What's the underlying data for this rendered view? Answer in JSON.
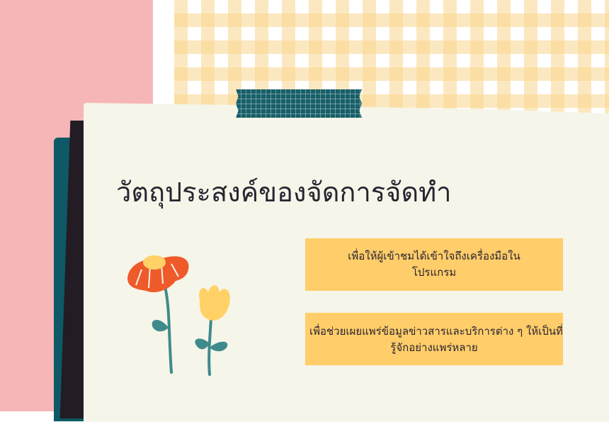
{
  "slide": {
    "title": "วัตถุประสงค์ของจัดการจัดทำ",
    "objectives": [
      {
        "line1": "เพื่อให้ผู้เข้าชมได้เข้าใจถึงเครื่องมือใน",
        "line2": "โปรแกรม"
      },
      {
        "line1": "เพื่อช่วยเผยแพร่ข้อมูลข่าวสารและบริการต่าง ๆ ให้เป็นที่",
        "line2": "รู้จักอย่างแพร่หลาย"
      }
    ]
  },
  "colors": {
    "pink": "#f6b6b7",
    "teal": "#0d5965",
    "dark": "#231c24",
    "paper": "#f6f5e9",
    "card": "#ffcd6a",
    "flower_orange": "#ef5a2a",
    "flower_yellow": "#ffd166",
    "stem": "#3f8a8c"
  },
  "decor": {
    "flowers": [
      "orange-daisy-icon",
      "yellow-tulip-icon"
    ]
  }
}
